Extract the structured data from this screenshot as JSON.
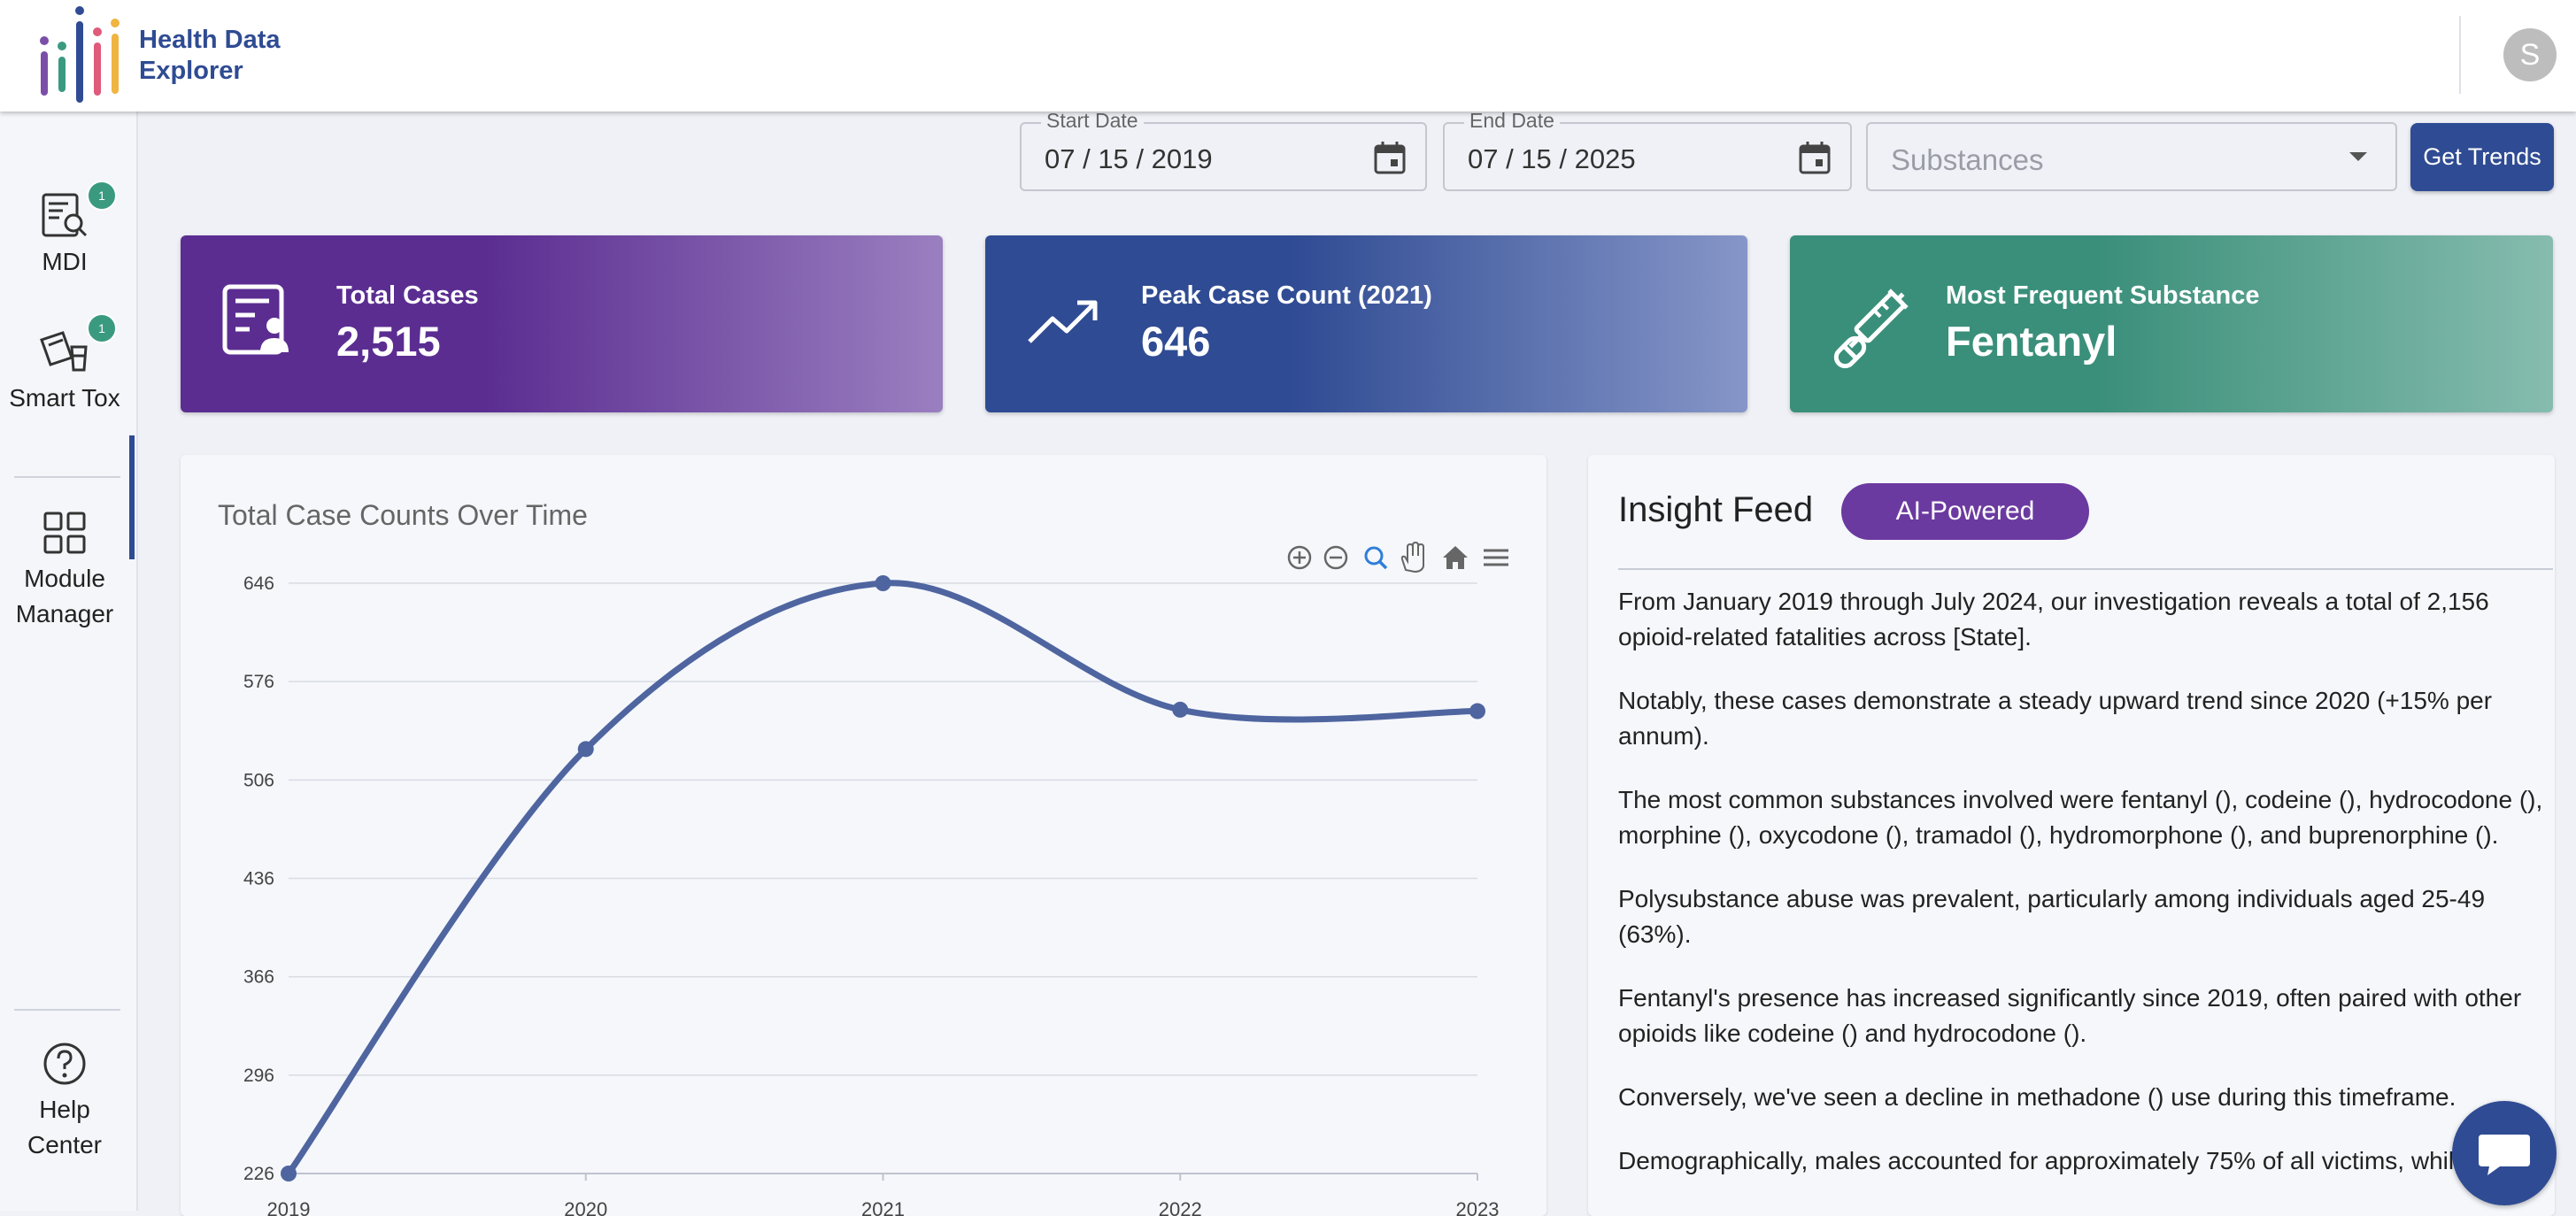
{
  "app": {
    "name_line1": "Health Data",
    "name_line2": "Explorer",
    "avatar_initial": "S"
  },
  "sidebar": {
    "items": [
      {
        "label": "MDI",
        "badge": "1",
        "icon": "search-document-icon"
      },
      {
        "label": "Smart Tox",
        "badge": "1",
        "icon": "lab-report-icon",
        "active": true
      },
      {
        "label": "Module Manager",
        "icon": "grid-icon"
      },
      {
        "label": "Help Center",
        "icon": "help-circle-icon"
      }
    ]
  },
  "filters": {
    "start_date": {
      "label": "Start Date",
      "value": "07 / 15 / 2019"
    },
    "end_date": {
      "label": "End Date",
      "value": "07 / 15 / 2025"
    },
    "substances": {
      "placeholder": "Substances"
    },
    "get_trends_label": "Get Trends"
  },
  "cards": [
    {
      "title": "Total Cases",
      "value": "2,515",
      "color": "#5b2d91"
    },
    {
      "title": "Peak Case Count (2021)",
      "value": "646",
      "color": "#2f4b93"
    },
    {
      "title": "Most Frequent Substance",
      "value": "Fentanyl",
      "color": "#3a8f7a"
    }
  ],
  "chart": {
    "title": "Total Case Counts Over Time"
  },
  "chart_data": {
    "type": "line",
    "title": "Total Case Counts Over Time",
    "x": [
      "2019",
      "2020",
      "2021",
      "2022",
      "2023"
    ],
    "series": [
      {
        "values": [
          226,
          528,
          646,
          556,
          555
        ],
        "color": "#4f65a0"
      }
    ],
    "y_ticks": [
      646,
      576,
      506,
      436,
      366,
      296,
      226
    ],
    "ylim": [
      226,
      646
    ],
    "grid": true,
    "smooth": true
  },
  "insights": {
    "title": "Insight Feed",
    "badge": "AI-Powered",
    "paragraphs": [
      "From January 2019 through July 2024, our investigation reveals a total of 2,156 opioid-related fatalities across [State].",
      "Notably, these cases demonstrate a steady upward trend since 2020 (+15% per annum).",
      "The most common substances involved were fentanyl (), codeine (), hydrocodone (), morphine (), oxycodone (), tramadol (), hydromorphone (), and buprenorphine ().",
      "Polysubstance abuse was prevalent, particularly among individuals aged 25-49 (63%).",
      "Fentanyl's presence has increased significantly since 2019, often paired with other opioids like codeine () and hydrocodone ().",
      "Conversely, we've seen a decline in methadone () use during this timeframe.",
      "Demographically, males accounted for approximately 75% of all victims, while t"
    ]
  }
}
